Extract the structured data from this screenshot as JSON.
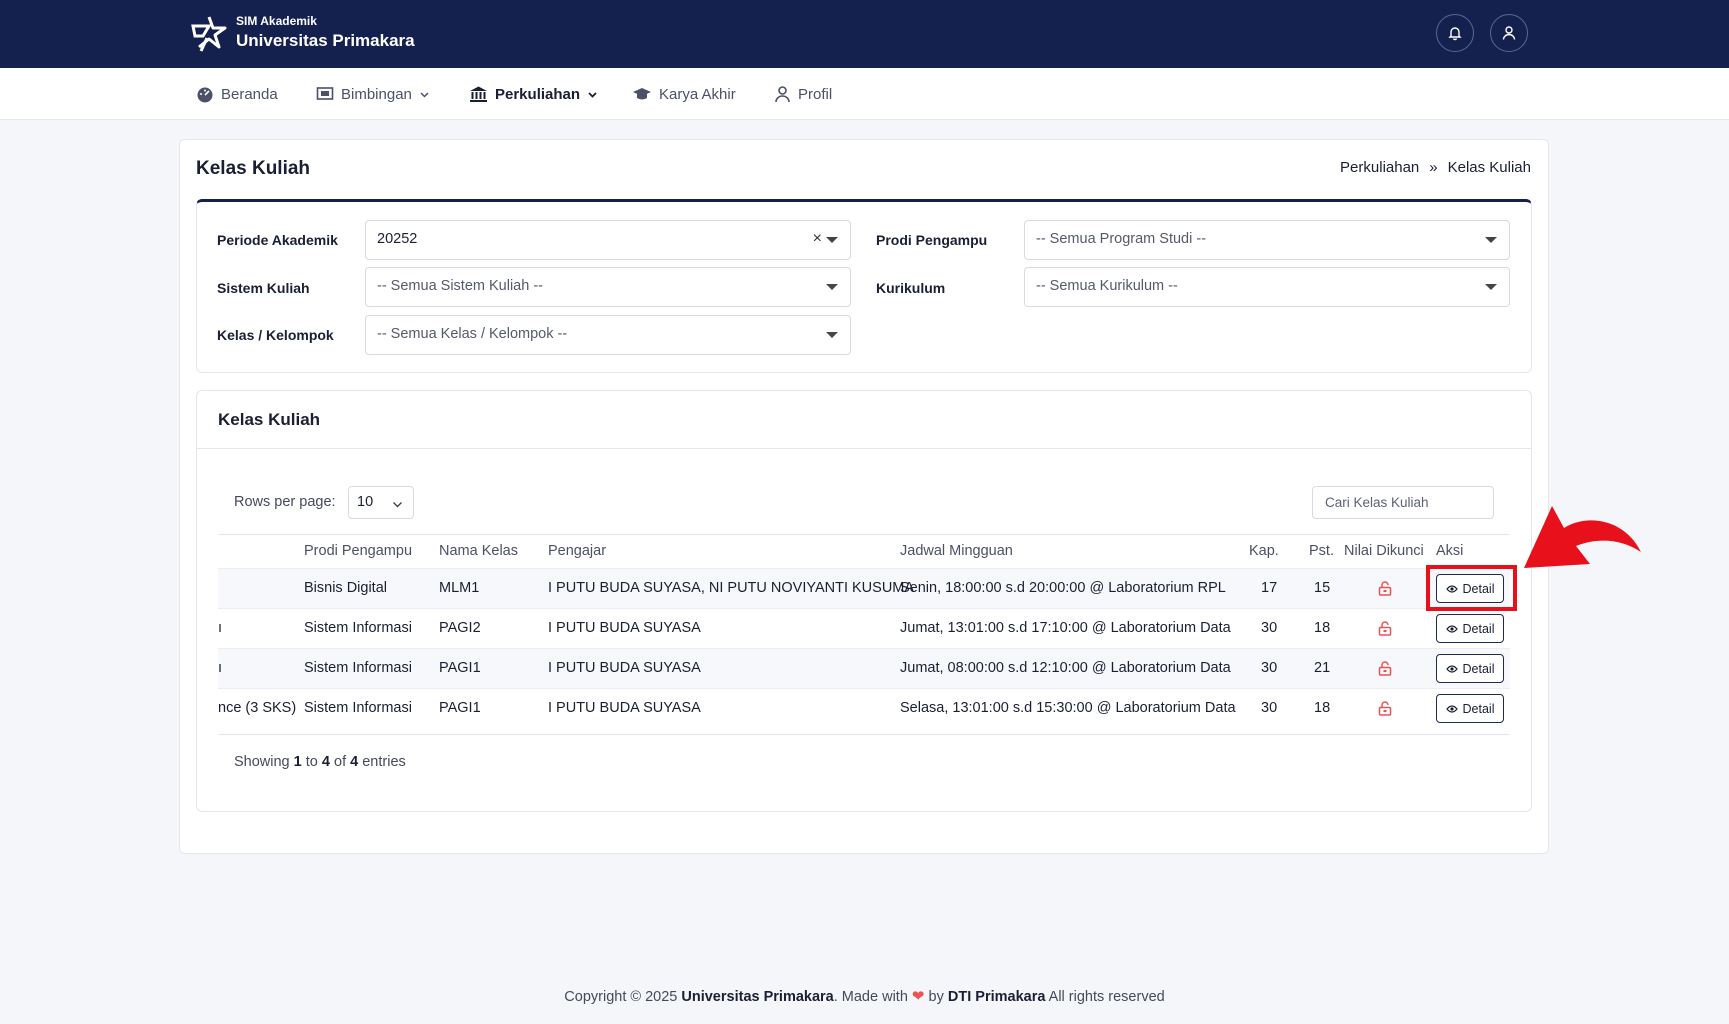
{
  "header": {
    "app_subtitle": "SIM Akademik",
    "app_title": "Universitas Primakara"
  },
  "nav": [
    {
      "label": "Beranda",
      "icon": "dashboard-icon"
    },
    {
      "label": "Bimbingan",
      "icon": "presentation-icon",
      "dropdown": true
    },
    {
      "label": "Perkuliahan",
      "icon": "institution-icon",
      "dropdown": true,
      "active": true
    },
    {
      "label": "Karya Akhir",
      "icon": "graduation-cap-icon"
    },
    {
      "label": "Profil",
      "icon": "user-icon"
    }
  ],
  "page": {
    "title": "Kelas Kuliah",
    "breadcrumb": [
      "Perkuliahan",
      "»",
      "Kelas Kuliah"
    ]
  },
  "filters": {
    "periode_label": "Periode Akademik",
    "periode_value": "20252",
    "sistem_label": "Sistem Kuliah",
    "sistem_value": "-- Semua Sistem Kuliah --",
    "kelas_label": "Kelas / Kelompok",
    "kelas_value": "-- Semua Kelas / Kelompok --",
    "prodi_label": "Prodi Pengampu",
    "prodi_value": "-- Semua Program Studi --",
    "kurikulum_label": "Kurikulum",
    "kurikulum_value": "-- Semua Kurikulum --"
  },
  "table_card": {
    "title": "Kelas Kuliah",
    "rows_per_page_label": "Rows per page:",
    "rows_per_page_value": "10",
    "search_placeholder": "Cari Kelas Kuliah"
  },
  "table": {
    "headers": {
      "prodi": "Prodi Pengampu",
      "nama_kelas": "Nama Kelas",
      "pengajar": "Pengajar",
      "jadwal": "Jadwal Mingguan",
      "kap": "Kap.",
      "pst": "Pst.",
      "nilai": "Nilai Dikunci",
      "aksi": "Aksi"
    },
    "rows": [
      {
        "cut": "",
        "prodi": "Bisnis Digital",
        "kelas": "MLM1",
        "pengajar": "I PUTU BUDA SUYASA, NI PUTU NOVIYANTI KUSUMA",
        "jadwal": "Senin, 18:00:00 s.d 20:00:00 @ Laboratorium RPL",
        "kap": "17",
        "pst": "15",
        "action": "Detail"
      },
      {
        "cut": "ı",
        "prodi": "Sistem Informasi",
        "kelas": "PAGI2",
        "pengajar": "I PUTU BUDA SUYASA",
        "jadwal": "Jumat, 13:01:00 s.d 17:10:00 @ Laboratorium Data",
        "kap": "30",
        "pst": "18",
        "action": "Detail"
      },
      {
        "cut": "ı",
        "prodi": "Sistem Informasi",
        "kelas": "PAGI1",
        "pengajar": "I PUTU BUDA SUYASA",
        "jadwal": "Jumat, 08:00:00 s.d 12:10:00 @ Laboratorium Data",
        "kap": "30",
        "pst": "21",
        "action": "Detail"
      },
      {
        "cut": "nce (3 SKS)",
        "prodi": "Sistem Informasi",
        "kelas": "PAGI1",
        "pengajar": "I PUTU BUDA SUYASA",
        "jadwal": "Selasa, 13:01:00 s.d 15:30:00 @ Laboratorium Data",
        "kap": "30",
        "pst": "18",
        "action": "Detail"
      }
    ]
  },
  "entries": {
    "prefix": "Showing",
    "from": "1",
    "to_word": "to",
    "to": "4",
    "of_word": "of",
    "total": "4",
    "suffix": "entries"
  },
  "footer": {
    "prefix": "Copyright © 2025",
    "org": "Universitas Primakara",
    "made_with": ". Made with",
    "by": "by",
    "team": "DTI Primakara",
    "rights": "All rights reserved"
  },
  "colors": {
    "header_bg": "#14214f",
    "accent_red": "#e8101a",
    "lock_red": "#ec5353"
  }
}
